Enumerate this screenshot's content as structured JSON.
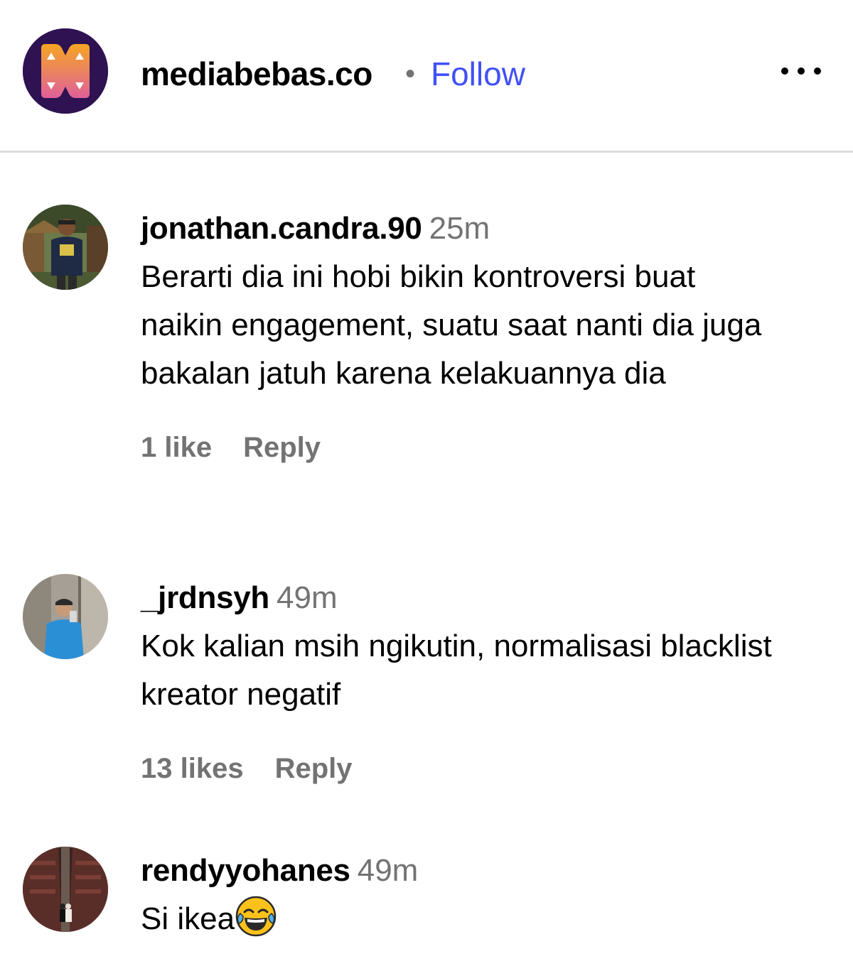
{
  "header": {
    "account_name": "mediabebas.co",
    "separator": "•",
    "follow_label": "Follow",
    "more_icon": "more-horizontal-icon",
    "avatar_colors": {
      "background": "#2e1252",
      "logo_top": "#f5a623",
      "logo_bottom": "#e0609a"
    }
  },
  "colors": {
    "follow": "#4150f7",
    "secondary_text": "#737373",
    "divider": "#dbdbdb"
  },
  "comments": [
    {
      "username": "jonathan.candra.90",
      "time": "25m",
      "text": "Berarti dia ini hobi bikin kontroversi buat naikin engagement, suatu saat nanti dia juga bakalan jatuh karena kelakuannya dia",
      "likes": "1 like",
      "reply_label": "Reply"
    },
    {
      "username": "_jrdnsyh",
      "time": "49m",
      "text": "Kok kalian msih ngikutin, normalisasi blacklist kreator negatif",
      "likes": "13 likes",
      "reply_label": "Reply"
    },
    {
      "username": "rendyyohanes",
      "time": "49m",
      "text": "Si ikea",
      "emoji": "face-with-tears-of-joy"
    }
  ]
}
